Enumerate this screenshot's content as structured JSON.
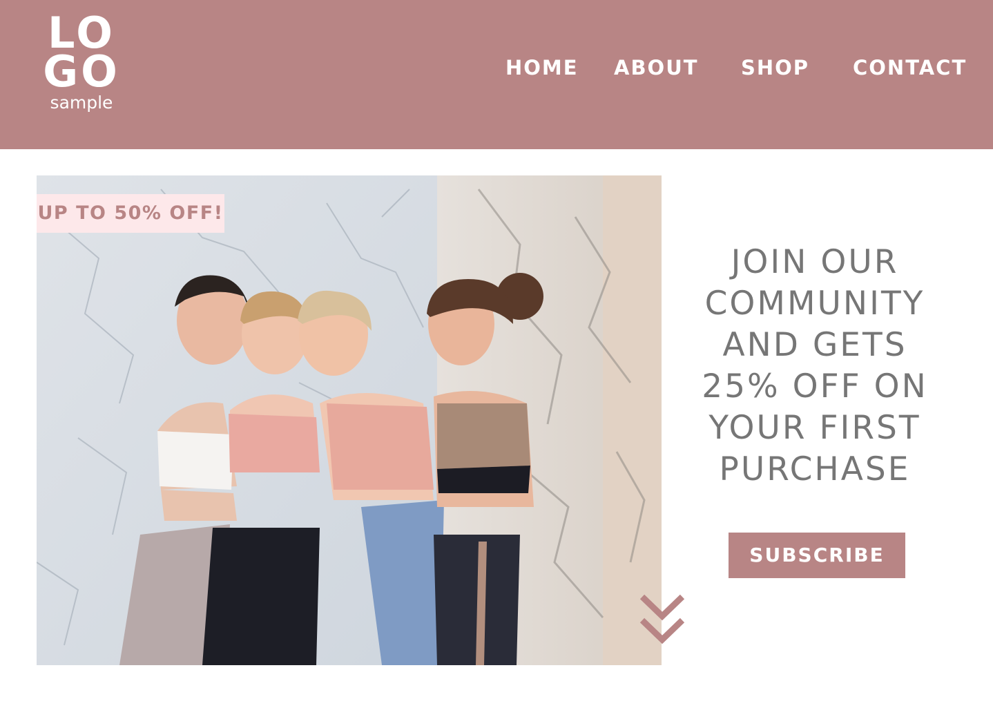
{
  "header": {
    "logo": {
      "line1": "LO",
      "line2": "GO",
      "sub": "sample"
    },
    "nav": [
      {
        "label": "HOME"
      },
      {
        "label": "ABOUT"
      },
      {
        "label": "SHOP"
      },
      {
        "label": "CONTACT"
      }
    ]
  },
  "hero": {
    "badge": "UP TO 50% OFF!",
    "headline": [
      "JOIN OUR",
      "COMMUNITY",
      "AND GETS",
      "25% OFF ON",
      "YOUR FIRST",
      "PURCHASE"
    ],
    "subscribe_label": "SUBSCRIBE",
    "scroll_icon": "double-chevron-down-icon"
  },
  "colors": {
    "brand": "#b88585",
    "badge_bg": "#fde8ea",
    "text_gray": "#767676",
    "white": "#ffffff"
  }
}
